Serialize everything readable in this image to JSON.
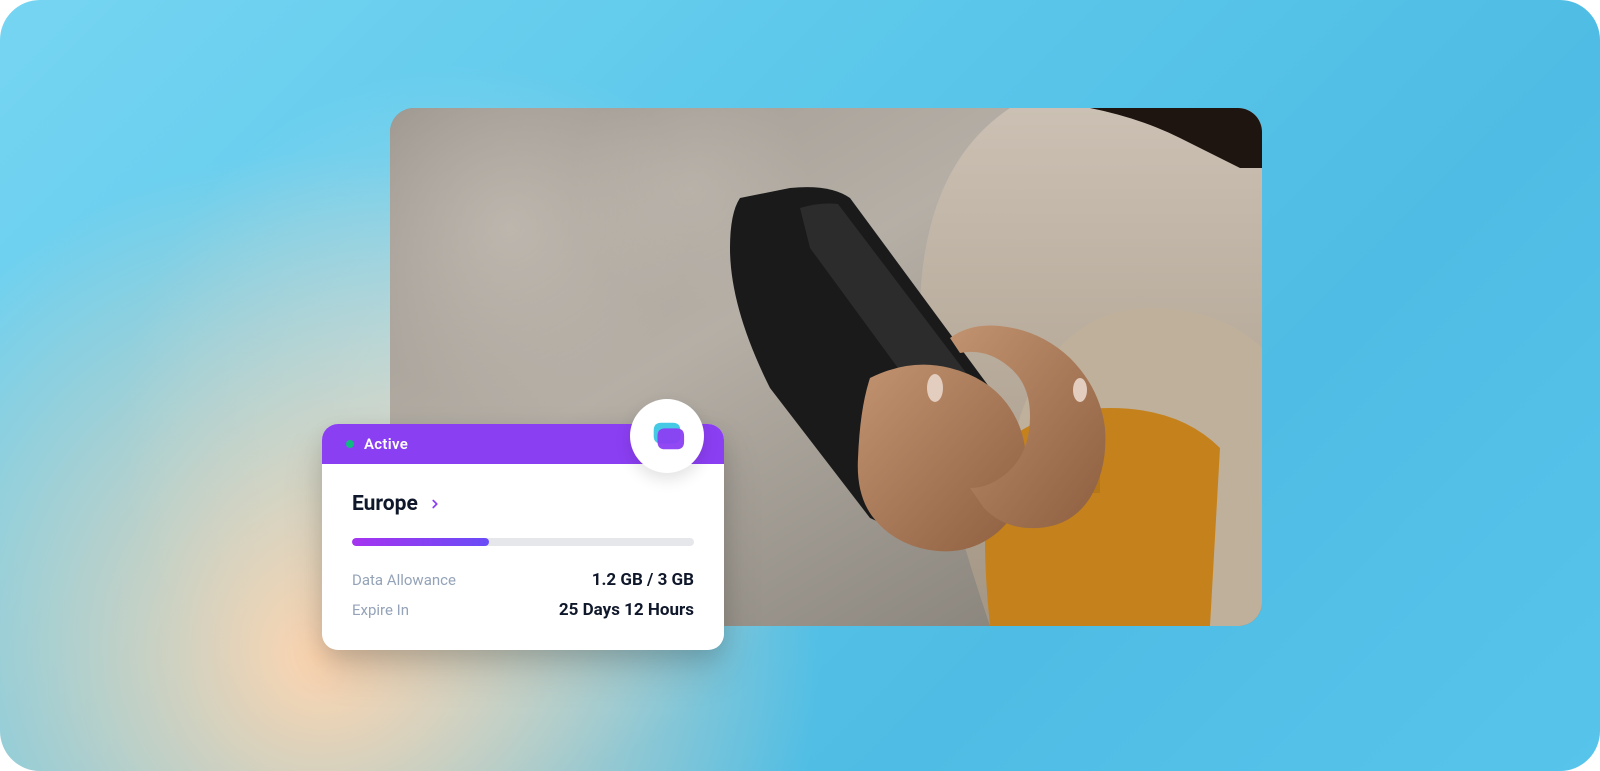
{
  "card": {
    "status": {
      "label": "Active",
      "dot_color": "#10b981"
    },
    "region": {
      "name": "Europe"
    },
    "data_allowance": {
      "label": "Data Allowance",
      "value": "1.2 GB / 3 GB",
      "used": 1.2,
      "total": 3,
      "progress_percent": 40
    },
    "expire_in": {
      "label": "Expire In",
      "value": "25 Days 12 Hours"
    }
  },
  "colors": {
    "accent": "#8b3ff2",
    "status_green": "#10b981",
    "text_muted": "#94a3b8",
    "text_dark": "#0f172a"
  }
}
